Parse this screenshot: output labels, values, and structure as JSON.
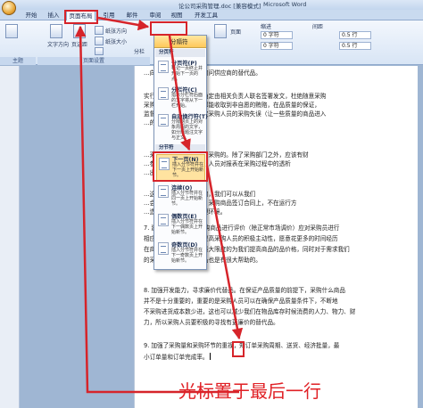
{
  "window": {
    "title": "论公司采购管理.doc [兼容模式]",
    "app_name": "Microsoft Word"
  },
  "tabs": [
    "开始",
    "插入",
    "页面布局",
    "引用",
    "邮件",
    "审阅",
    "视图",
    "开发工具"
  ],
  "ribbon": {
    "theme_label": "主题",
    "page_setup_label": "页面设置",
    "text_direction": "文字方向",
    "margins": "页边距",
    "orientation": "纸张方向",
    "size": "纸张大小",
    "columns": "分栏",
    "breaks_button": "分隔符",
    "page_background_label": "页面",
    "indent_label": "缩进",
    "spacing_label": "间距",
    "indent_left": "0 字符",
    "indent_right": "0 字符",
    "spacing_before": "0.5 行",
    "spacing_after": "0.5 行"
  },
  "breaks_menu": {
    "header": "分隔符",
    "section_page_breaks": "分页符",
    "section_section_breaks": "分节符",
    "items": [
      {
        "title": "分页符(P)",
        "desc": "标记一页终止并开始下一页的点。"
      },
      {
        "title": "分栏符(C)",
        "desc": "指示分栏符后面的文字将从下一栏开始。"
      },
      {
        "title": "自动换行符(T)",
        "desc": "分隔网页上的对象周围的文字，如分隔题注文字与正文。"
      },
      {
        "title": "下一页(N)",
        "desc": "插入分节符并在下一页上开始新节。"
      },
      {
        "title": "连续(O)",
        "desc": "插入分节符并在同一页上开始新节。"
      },
      {
        "title": "偶数页(E)",
        "desc": "插入分节符并在下一偶数页上开始新节。"
      },
      {
        "title": "奇数页(D)",
        "desc": "插入分节符并在下一奇数页上开始新节。"
      }
    ]
  },
  "document": {
    "lines": [
      "…向供应商采购货物，询问供应商的替代品。",
      "实行采购负责人制度，确定由相关负责人联名签署发文，杜绝随意采购",
      "采购时，采购中心人员都能收取到非自愿的贿赂，在品质量的保证，",
      "监督采购员的工作，制定采购人员的采购失误（让一些质量的商品进入",
      "…的出现）。",
      "…采购的行为和方式进行采购的。除了采购部门之外，应该有财",
      "…参与采购过程中，财务人员对报表在采购过程中的透析",
      "…出漏洞，及时找漏。",
      "…这个程序是必不可少的，我们可以从我们",
      "…会计中心的监督机制，采购商品签订合同上，不在运行方",
      "…造一个更加良好的管理环境。",
      "7. 建立奖励制度，对采购商品进行评价（除正常市场调价）应对采购员进行",
      "相应的奖励，这有助于提高采购人员的积极主动性，愿意花更多的时间经历",
      "在商品采购上面去，既最大限度的为我们提高商品的品价格，同时对于需求我们",
      "的采购享受的良好替代品也是有很大帮助的。",
      "8. 加强开发能力，寻求廉价代替品。在保证产品质量的前提下，采购什么商品",
      "并不是十分重要的，重要的是采购人员可以在确保产品质量条件下，不断地",
      "不采购进货成本数少进，这也可以减少我们在物品库存时候消费的人力、物力、财",
      "力，所以采购人员要积极的寻找有更廉价的替代品。",
      "9. 加强了采购量和采购环节的重视，知订单采购周期、送货、经济批量，最",
      "小订单量和订单完成率。"
    ]
  },
  "annotation": "光标置于最后一行",
  "colors": {
    "highlight_red": "#d6242a",
    "menu_highlight": "#ffe3a0",
    "ribbon_blue": "#c9daef"
  }
}
